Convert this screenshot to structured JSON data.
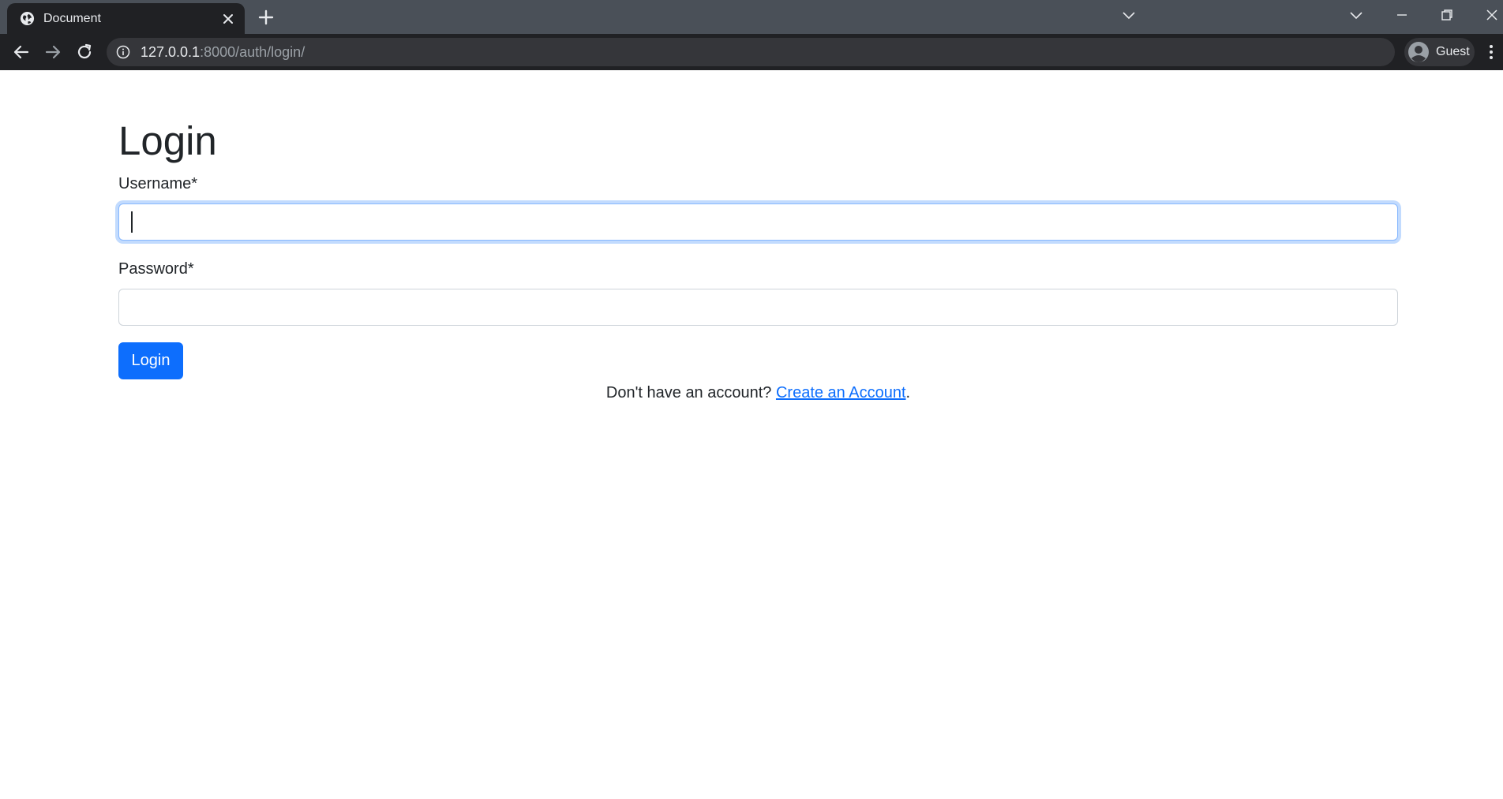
{
  "browser": {
    "tab": {
      "title": "Document",
      "favicon": "globe-icon"
    },
    "address_bar": {
      "host": "127.0.0.1",
      "path": ":8000/auth/login/"
    },
    "profile": {
      "label": "Guest"
    },
    "colors": {
      "frame": "#4a5058",
      "toolbar": "#202124",
      "omnibox": "#35363a"
    }
  },
  "login_form": {
    "title": "Login",
    "username": {
      "label": "Username*",
      "value": ""
    },
    "password": {
      "label": "Password*",
      "value": ""
    },
    "submit_label": "Login",
    "signup_prompt": "Don't have an account? ",
    "signup_link_label": "Create an Account",
    "signup_suffix": "."
  },
  "colors": {
    "primary": "#0d6efd",
    "text": "#212529",
    "input_border": "#ced4da",
    "focus_border": "#86b7fe"
  }
}
